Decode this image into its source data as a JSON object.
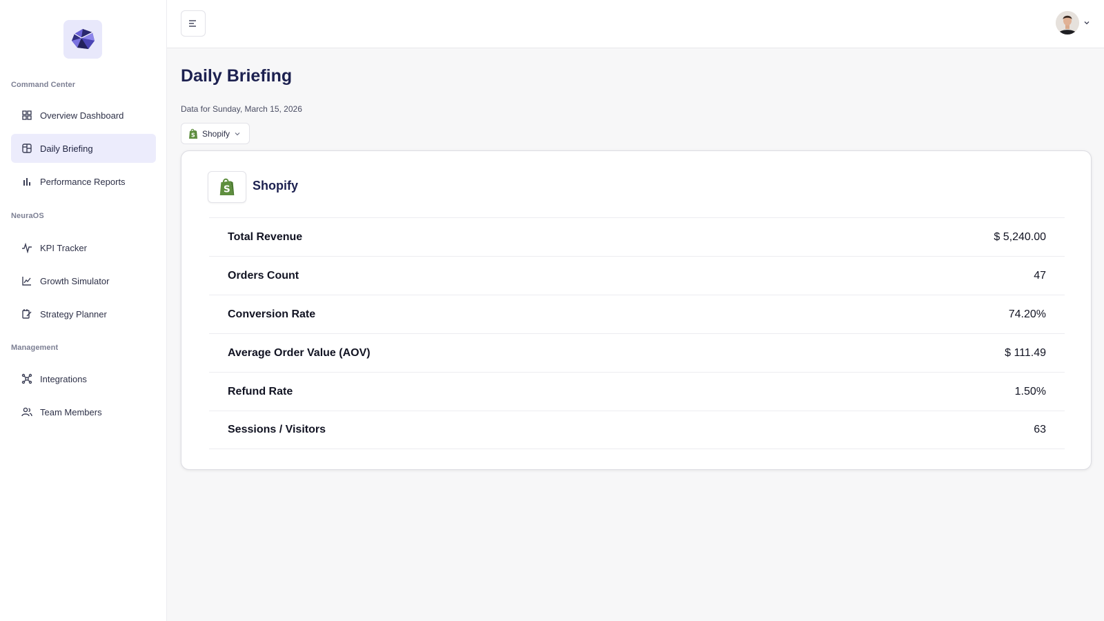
{
  "sidebar": {
    "sections": [
      {
        "title": "Command Center"
      },
      {
        "title": "NeuraOS"
      },
      {
        "title": "Management"
      }
    ],
    "items": [
      {
        "label": "Overview Dashboard",
        "icon": "grid-icon"
      },
      {
        "label": "Daily Briefing",
        "icon": "layout-icon",
        "active": true
      },
      {
        "label": "Performance Reports",
        "icon": "bar-chart-icon"
      },
      {
        "label": "KPI Tracker",
        "icon": "activity-icon"
      },
      {
        "label": "Growth Simulator",
        "icon": "line-chart-icon"
      },
      {
        "label": "Strategy Planner",
        "icon": "edit-icon"
      },
      {
        "label": "Integrations",
        "icon": "network-icon"
      },
      {
        "label": "Team Members",
        "icon": "users-icon"
      }
    ]
  },
  "main": {
    "title": "Daily Briefing",
    "subtitle": "Data for Sunday, March 15, 2026",
    "source_select": {
      "value": "Shopify"
    }
  },
  "card": {
    "name": "Shopify",
    "metrics": [
      {
        "label": "Total Revenue",
        "value": "$ 5,240.00"
      },
      {
        "label": "Orders Count",
        "value": "47"
      },
      {
        "label": "Conversion Rate",
        "value": "74.20%"
      },
      {
        "label": "Average Order Value (AOV)",
        "value": "$ 111.49"
      },
      {
        "label": "Refund Rate",
        "value": "1.50%"
      },
      {
        "label": "Sessions / Visitors",
        "value": "63"
      }
    ]
  },
  "colors": {
    "accent_bg": "#ececfc",
    "title": "#1d2150",
    "shopify_green": "#5e8e3e"
  }
}
